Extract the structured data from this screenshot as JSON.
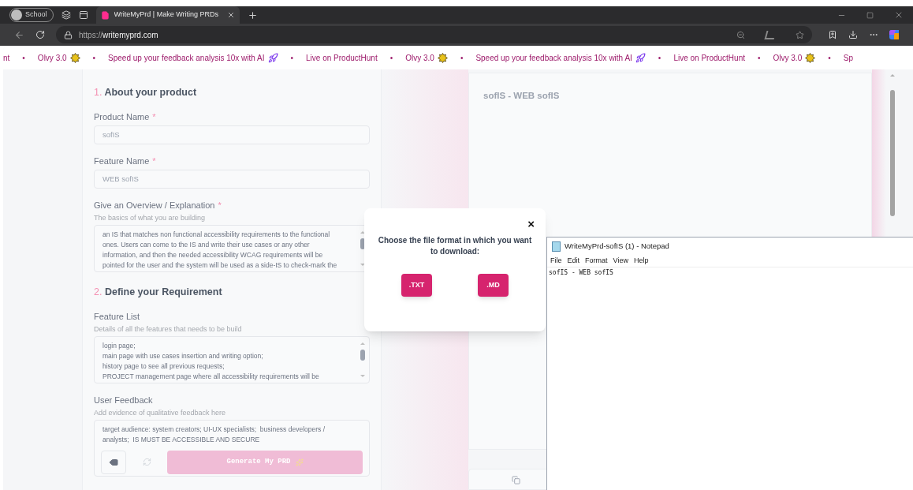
{
  "browser": {
    "profile": "School",
    "tab_title": "WriteMyPrd | Make Writing PRDs",
    "url_scheme": "https://",
    "url_host": "writemyprd.com"
  },
  "ticker": [
    {
      "text": "nt",
      "kind": "plain"
    },
    {
      "text": "Olvy 3.0",
      "kind": "release"
    },
    {
      "text": "Speed up your feedback analysis 10x with AI",
      "kind": "promo"
    },
    {
      "text": "Live on ProductHunt",
      "kind": "plain"
    },
    {
      "text": "Olvy 3.0",
      "kind": "release"
    },
    {
      "text": "Speed up your feedback analysis 10x with AI",
      "kind": "promo"
    },
    {
      "text": "Live on ProductHunt",
      "kind": "plain"
    },
    {
      "text": "Olvy 3.0",
      "kind": "release"
    },
    {
      "text": "Sp",
      "kind": "plain"
    }
  ],
  "ticker_separator": "•",
  "form": {
    "sections": [
      {
        "number": "1.",
        "title": "About your product",
        "fields": [
          {
            "kind": "input",
            "label": "Product Name",
            "mark": "*",
            "value": "sofIS"
          },
          {
            "kind": "input",
            "label": "Feature Name",
            "mark": "*",
            "value": "WEB sofIS"
          },
          {
            "kind": "textarea",
            "label": "Give an Overview / Explanation",
            "mark": "*",
            "hint": "The basics of what you are building",
            "value": "an IS that matches non functional accessibility requirements to the functional\nones. Users can come to the IS and write their use cases or any other\ninformation, and then the needed accessibility WCAG requirements will be\npointed for the user and the system will be used as a side-IS to check-mark the"
          }
        ]
      },
      {
        "number": "2.",
        "title": "Define your Requirement",
        "fields": [
          {
            "kind": "textarea",
            "label": "Feature List",
            "hint": "Details of all the features that needs to be build",
            "value": "login page;\nmain page with use cases insertion and writing option;\nhistory page to see all previous requests;\nPROJECT management page where all accessibility requirements will be"
          },
          {
            "kind": "feedback",
            "label": "User Feedback",
            "hint": "Add evidence of qualitative feedback here",
            "value": "target audience: system creators; UI-UX specialists;  business developers /\nanalysts;  IS MUST BE ACCESSIBLE AND SECURE"
          }
        ]
      }
    ],
    "generate_button": "Generate My PRD"
  },
  "preview": {
    "text": "sofIS - WEB sofIS"
  },
  "modal": {
    "close": "×",
    "message": "Choose the file format in which you want to download:",
    "options": [
      ".TXT",
      ".MD"
    ]
  },
  "notepad": {
    "title": "WriteMyPrd-sofIS (1) - Notepad",
    "menu": [
      "File",
      "Edit",
      "Format",
      "View",
      "Help"
    ],
    "content": "sofIS - WEB sofIS"
  }
}
